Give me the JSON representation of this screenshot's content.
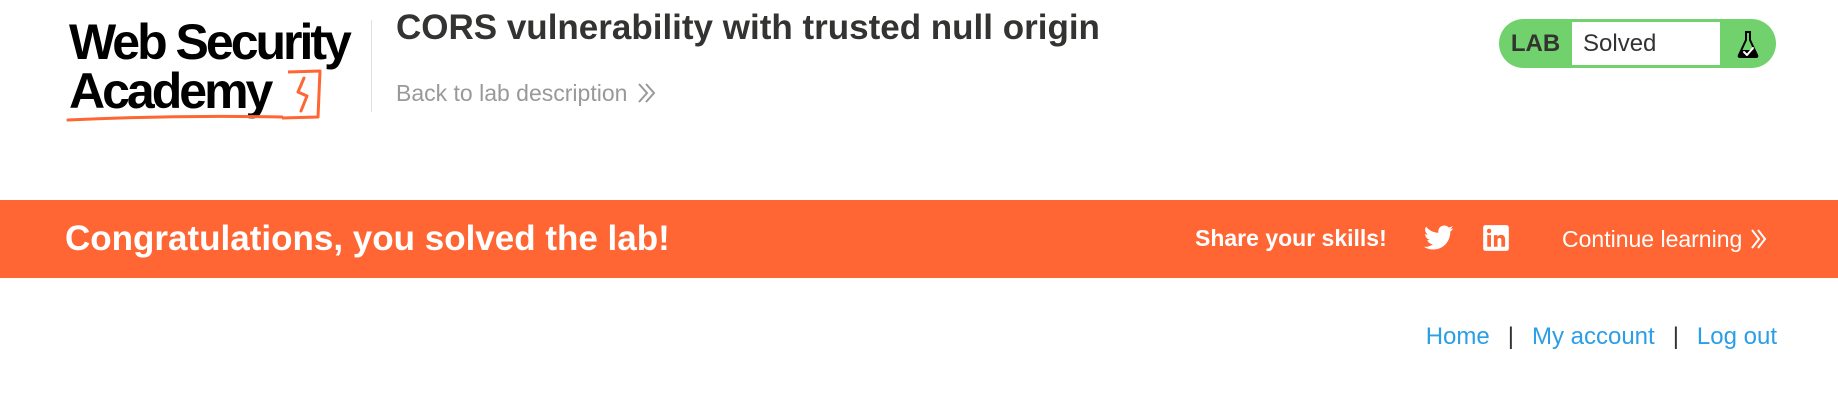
{
  "header": {
    "logo": {
      "line1": "Web Security",
      "line2": "Academy",
      "accent": "#ff6633"
    },
    "lab_title": "CORS vulnerability with trusted null origin",
    "back_link": {
      "label": "Back to lab description",
      "icon": "double-chevron-right-icon"
    }
  },
  "lab_status": {
    "label": "LAB",
    "value": "Solved",
    "icon": "flask-check-icon",
    "color": "#70d16d"
  },
  "banner": {
    "message": "Congratulations, you solved the lab!",
    "share_label": "Share your skills!",
    "share_icons": [
      "twitter-icon",
      "linkedin-icon"
    ],
    "continue_label": "Continue learning",
    "color": "#ff6633"
  },
  "nav": {
    "items": [
      {
        "label": "Home"
      },
      {
        "label": "My account"
      },
      {
        "label": "Log out"
      }
    ],
    "separator": "|",
    "link_color": "#2a9fe6"
  }
}
